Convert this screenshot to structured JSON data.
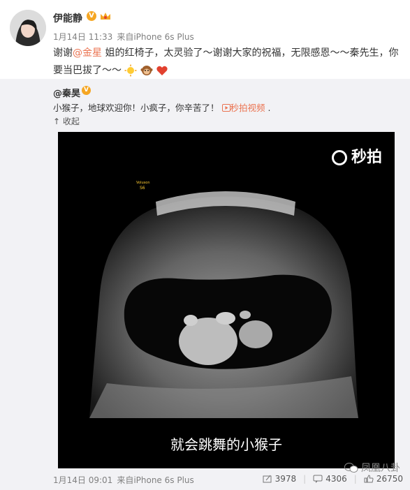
{
  "post": {
    "user_name": "伊能静",
    "date": "1月14日 11:33",
    "source": "来自iPhone 6s Plus",
    "text_part1": "谢谢",
    "mention": "@金星",
    "text_part2": " 姐的红椅子，太灵验了～谢谢大家的祝福，无限感恩～～秦先生，你要当巴拔了～～"
  },
  "repost": {
    "user_name": "@秦昊",
    "text": "小猴子，地球欢迎你！小疯子，你辛苦了！",
    "video_link": "秒拍视频",
    "text_end": ".",
    "collapse_label": "收起",
    "video": {
      "watermark": "秒拍",
      "subtitle": "就会跳舞的小猴子",
      "overlay_label1": "Voluson",
      "overlay_label2": "S6"
    },
    "date": "1月14日 09:01",
    "source": "来自iPhone 6s Plus",
    "repost_count": "3978",
    "comment_count": "4306",
    "like_count": "26750"
  },
  "watermark_text": "凤凰八卦",
  "colors": {
    "accent": "#eb7350",
    "vip": "#f5a623"
  }
}
